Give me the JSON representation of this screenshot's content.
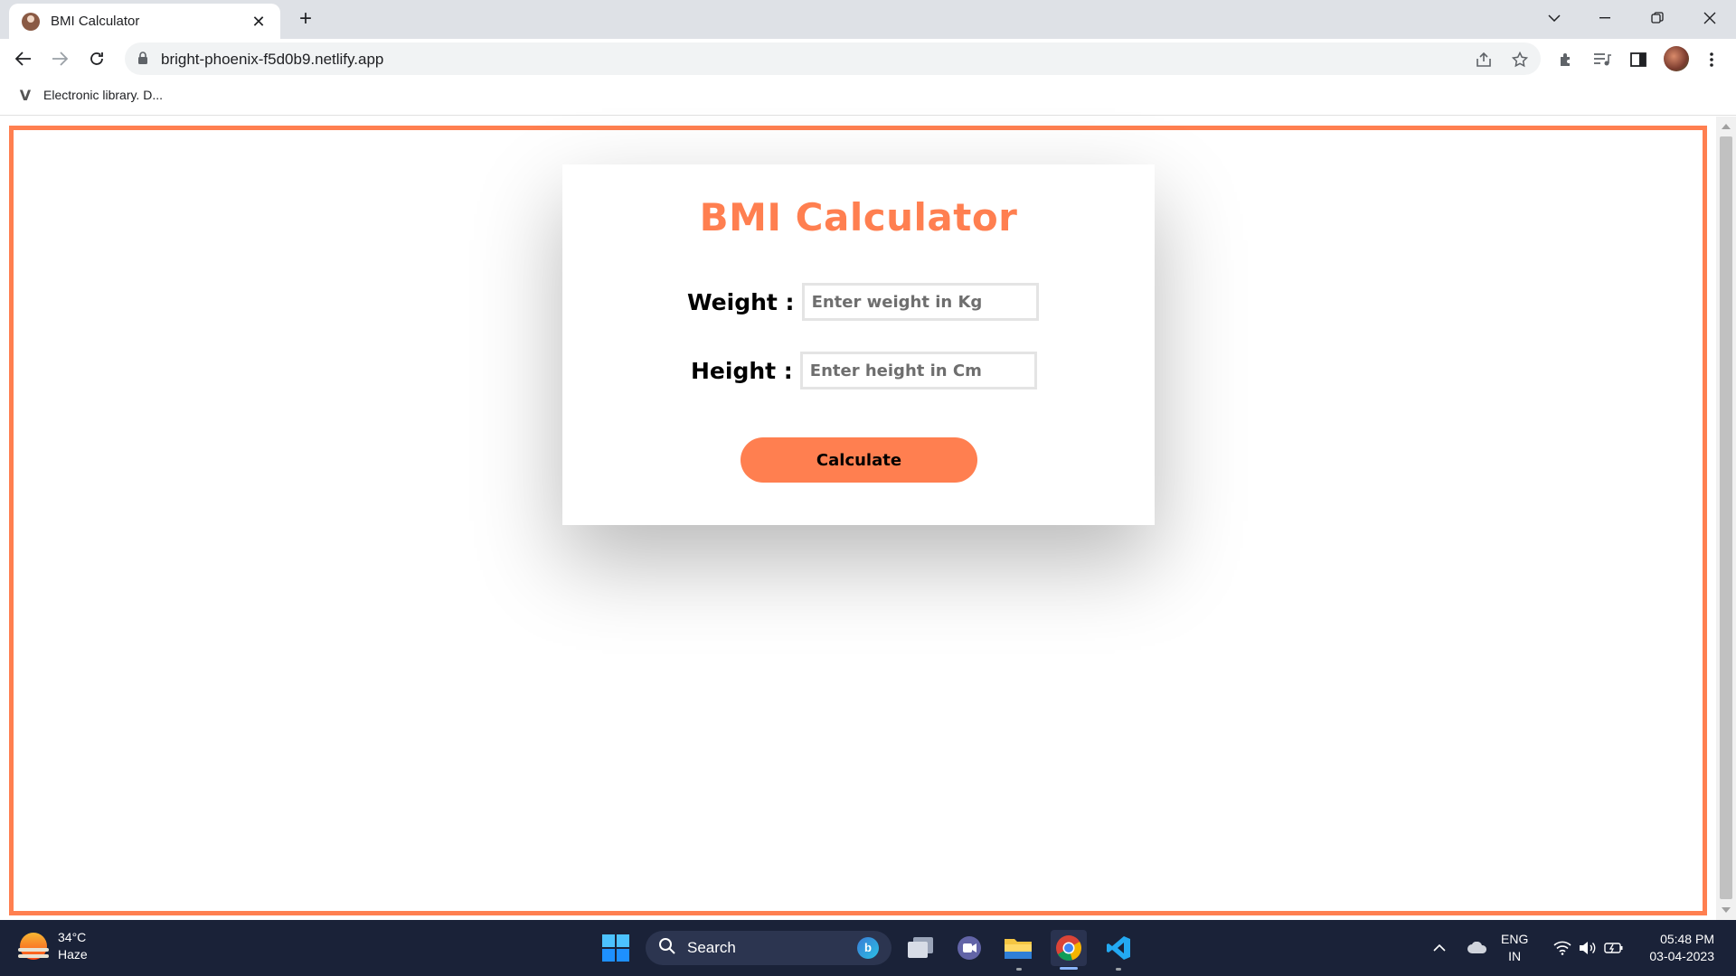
{
  "browser": {
    "tab_title": "BMI Calculator",
    "tab_close": "✕",
    "new_tab": "+",
    "url": "bright-phoenix-f5d0b9.netlify.app",
    "bookmark_label": "Electronic library. D...",
    "bookmark_icon": "V"
  },
  "page": {
    "heading": "BMI Calculator",
    "weight_label": "Weight :",
    "weight_placeholder": "Enter weight in Kg",
    "height_label": "Height :",
    "height_placeholder": "Enter height in Cm",
    "button_label": "Calculate",
    "accent_color": "#ff7f50"
  },
  "taskbar": {
    "temperature": "34°C",
    "condition": "Haze",
    "search_label": "Search",
    "lang_1": "ENG",
    "lang_2": "IN",
    "time": "05:48 PM",
    "date": "03-04-2023"
  }
}
